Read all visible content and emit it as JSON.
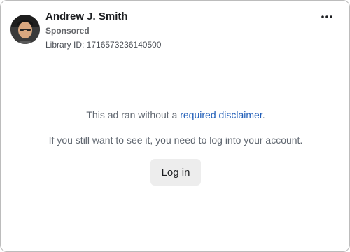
{
  "ad": {
    "advertiser_name": "Andrew J. Smith",
    "sponsored_label": "Sponsored",
    "library_id": "Library ID: 1716573236140500",
    "avatar_icon": "profile-photo",
    "more_icon": "more-horizontal-icon"
  },
  "notice": {
    "line1_prefix": "This ad ran without a ",
    "line1_link": "required disclaimer",
    "line1_suffix": ".",
    "line2": "If you still want to see it, you need to log into your account.",
    "link_color": "#1f5db8"
  },
  "login": {
    "button_label": "Log in"
  }
}
